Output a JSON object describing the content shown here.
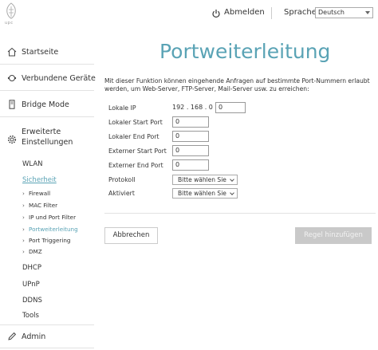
{
  "header": {
    "logo_text": "upc",
    "logout_label": "Abmelden",
    "language_label": "Sprache",
    "language_value": "Deutsch"
  },
  "sidebar": {
    "startseite": "Startseite",
    "verbundene": "Verbundene Geräte",
    "bridge": "Bridge Mode",
    "erweiterte_1": "Erweiterte",
    "erweiterte_2": "Einstellungen",
    "wlan": "WLAN",
    "sicherheit": "Sicherheit",
    "firewall": "Firewall",
    "mac_filter": "MAC Filter",
    "ip_port_filter": "IP und Port Filter",
    "portweiterleitung": "Portweiterleitung",
    "port_triggering": "Port Triggering",
    "dmz": "DMZ",
    "dhcp": "DHCP",
    "upnp": "UPnP",
    "ddns": "DDNS",
    "tools": "Tools",
    "admin": "Admin"
  },
  "main": {
    "title": "Portweiterleitung",
    "description": "Mit dieser Funktion können eingehende Anfragen auf bestimmte Port-Nummern erlaubt werden, um Web-Server, FTP-Server, Mail-Server usw. zu erreichen:",
    "lokale_ip_label": "Lokale IP",
    "ip_prefix": "192 . 168 . 0 .",
    "ip_last": "0",
    "lokaler_start_label": "Lokaler Start Port",
    "lokaler_start_value": "0",
    "lokaler_end_label": "Lokaler End Port",
    "lokaler_end_value": "0",
    "externer_start_label": "Externer Start Port",
    "externer_start_value": "0",
    "externer_end_label": "Externer End Port",
    "externer_end_value": "0",
    "protokoll_label": "Protokoll",
    "protokoll_value": "Bitte wählen Sie",
    "aktiviert_label": "Aktiviert",
    "aktiviert_value": "Bitte wählen Sie",
    "cancel_label": "Abbrechen",
    "add_label": "Regel hinzufügen"
  },
  "colors": {
    "accent": "#5aa3b5",
    "disabled_button": "#c9c9c9"
  }
}
